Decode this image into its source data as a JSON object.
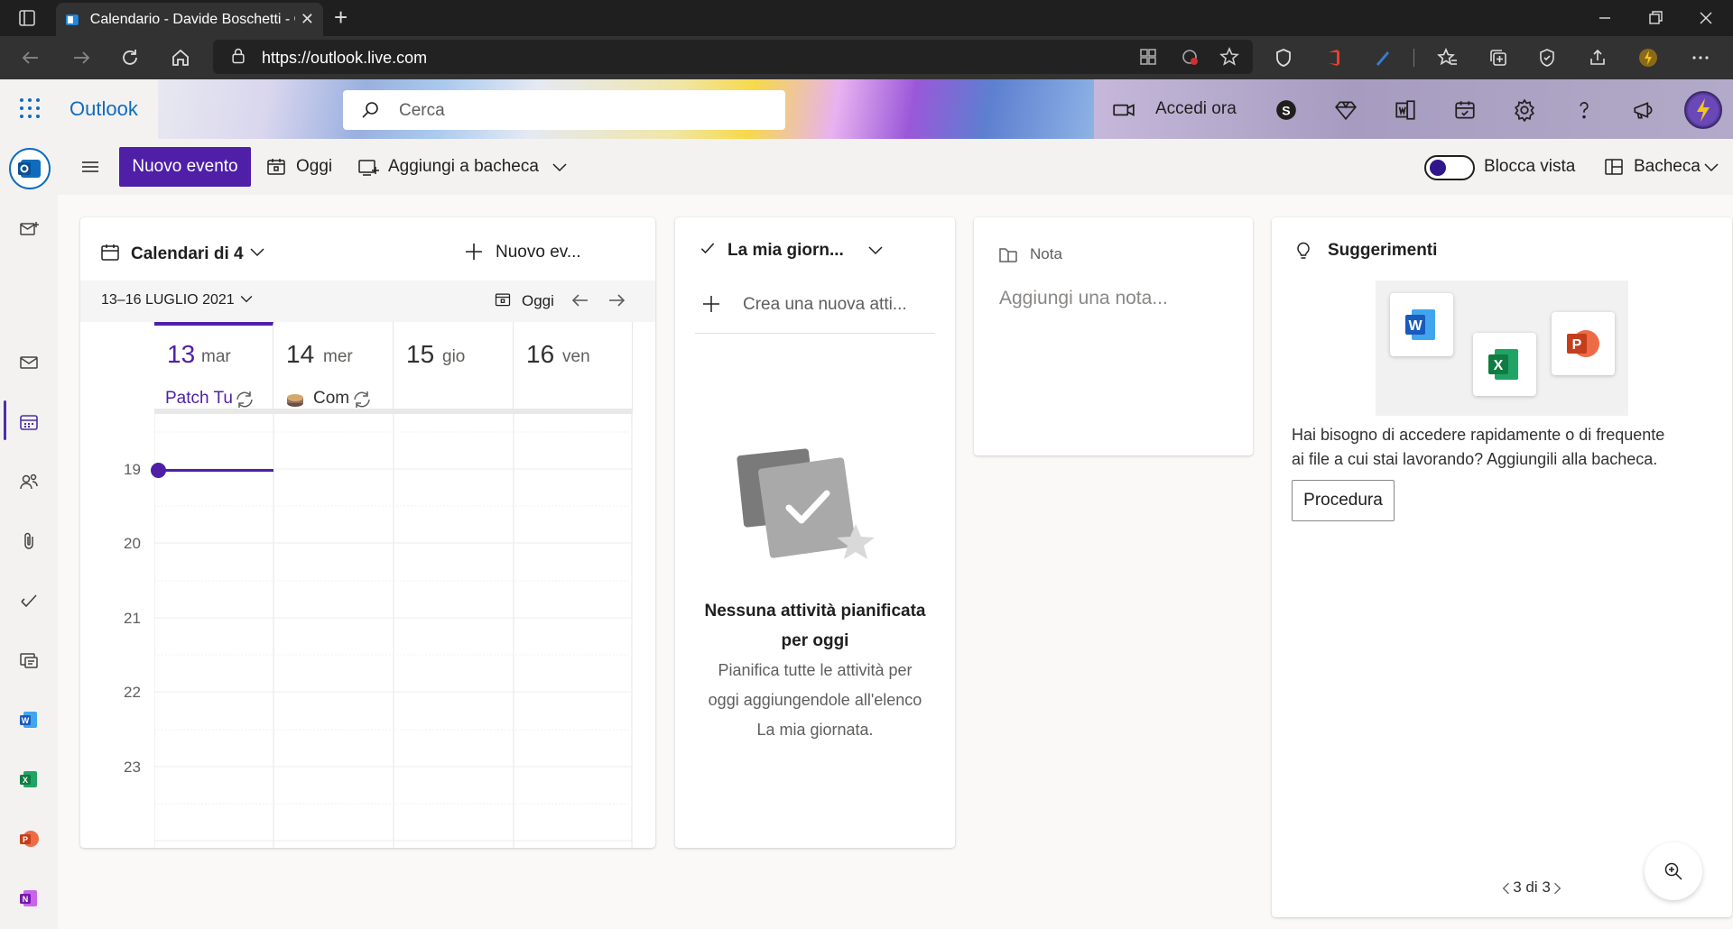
{
  "browser": {
    "tab_title": "Calendario - Davide Boschetti - Outlook",
    "tab_close": "✕",
    "new_tab": "+",
    "url": "https://outlook.live.com"
  },
  "header": {
    "app_name": "Outlook",
    "search_placeholder": "Cerca",
    "meet_now": "Accedi ora"
  },
  "command_bar": {
    "new_event": "Nuovo evento",
    "today": "Oggi",
    "add_to_board": "Aggiungi a bacheca",
    "lock_view": "Blocca vista",
    "board": "Bacheca"
  },
  "calendar_card": {
    "title": "Calendari di 4",
    "new_event": "Nuovo ev...",
    "date_range": "13–16 LUGLIO 2021",
    "today": "Oggi",
    "days": [
      {
        "num": "13",
        "weekday": "mar",
        "event": "Patch Tu"
      },
      {
        "num": "14",
        "weekday": "mer",
        "event": "Com"
      },
      {
        "num": "15",
        "weekday": "gio",
        "event": ""
      },
      {
        "num": "16",
        "weekday": "ven",
        "event": ""
      }
    ],
    "hours": [
      "19",
      "20",
      "21",
      "22",
      "23"
    ]
  },
  "myday_card": {
    "title": "La mia giorn...",
    "new_task": "Crea una nuova atti...",
    "empty_title_1": "Nessuna attività pianificata",
    "empty_title_2": "per oggi",
    "empty_text_1": "Pianifica tutte le attività per",
    "empty_text_2": "oggi aggiungendole all'elenco",
    "empty_text_3": "La mia giornata."
  },
  "note_card": {
    "title": "Nota",
    "placeholder": "Aggiungi una nota..."
  },
  "suggestions_card": {
    "title": "Suggerimenti",
    "text_1": "Hai bisogno di accedere rapidamente o di frequente",
    "text_2": "ai file a cui stai lavorando? Aggiungili alla bacheca.",
    "button": "Procedura",
    "pager": "3 di 3",
    "apps": {
      "word": "W",
      "excel": "X",
      "powerpoint": "P"
    }
  },
  "colors": {
    "accent": "#4f1fa8",
    "brand_blue": "#0f6cbd",
    "now_line": "#4f1fa8"
  }
}
